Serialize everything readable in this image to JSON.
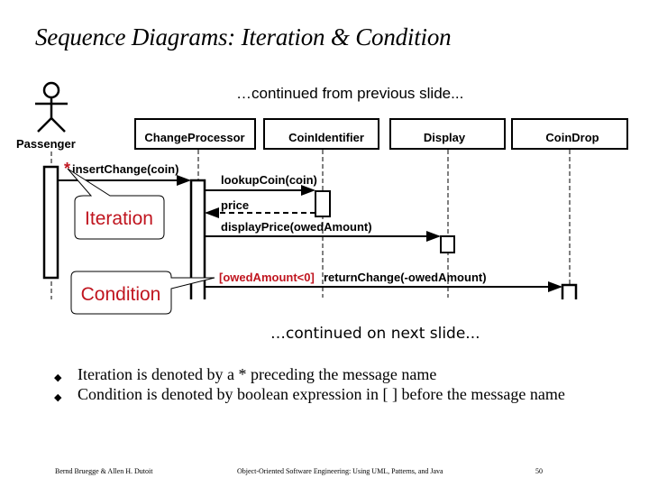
{
  "slide": {
    "title": "Sequence Diagrams: Iteration & Condition",
    "continued_from": "…continued from previous slide...",
    "continued_next": "…continued on next slide..."
  },
  "diagram": {
    "actor": {
      "name": "Passenger"
    },
    "objects": [
      "ChangeProcessor",
      "CoinIdentifier",
      "Display",
      "CoinDrop"
    ],
    "messages": {
      "iteration_marker": "*",
      "insert_change": "insertChange(coin)",
      "lookup_coin": "lookupCoin(coin)",
      "price": "price",
      "display_price": "displayPrice(owedAmount)",
      "condition_guard": "[owedAmount<0]",
      "return_change": "returnChange(-owedAmount)"
    },
    "callouts": {
      "iteration": "Iteration",
      "condition": "Condition"
    },
    "colors": {
      "accent_red": "#c0151f"
    }
  },
  "bullets": [
    {
      "icon": "diamond-bullet-icon",
      "text": "Iteration is denoted by a * preceding the message name"
    },
    {
      "icon": "diamond-bullet-icon",
      "text": "Condition is denoted by boolean expression in [ ] before the message name"
    }
  ],
  "footer": {
    "authors": "Bernd Bruegge & Allen H. Dutoit",
    "book": "Object-Oriented Software Engineering: Using UML, Patterns, and Java",
    "page": "50"
  }
}
